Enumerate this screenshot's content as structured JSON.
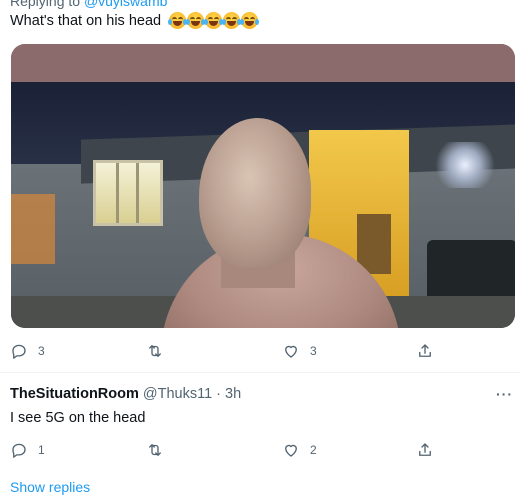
{
  "tweet": {
    "replying_label": "Replying to",
    "replying_handle": "@vuyiswamb",
    "text": "What's that on his head",
    "emoji_icon": "face-with-tears-of-joy-icon",
    "emoji_count": 5,
    "actions": {
      "reply_count": "3",
      "retweet_count": "",
      "like_count": "3"
    }
  },
  "reply": {
    "name": "TheSituationRoom",
    "handle": "@Thuks11",
    "separator": "·",
    "time": "3h",
    "more_label": "···",
    "text": "I see 5G on the head",
    "actions": {
      "reply_count": "1",
      "retweet_count": "",
      "like_count": "2"
    }
  },
  "show_replies_label": "Show replies",
  "colors": {
    "accent": "#1d9bf0",
    "text": "#0f1419",
    "muted": "#536471"
  }
}
